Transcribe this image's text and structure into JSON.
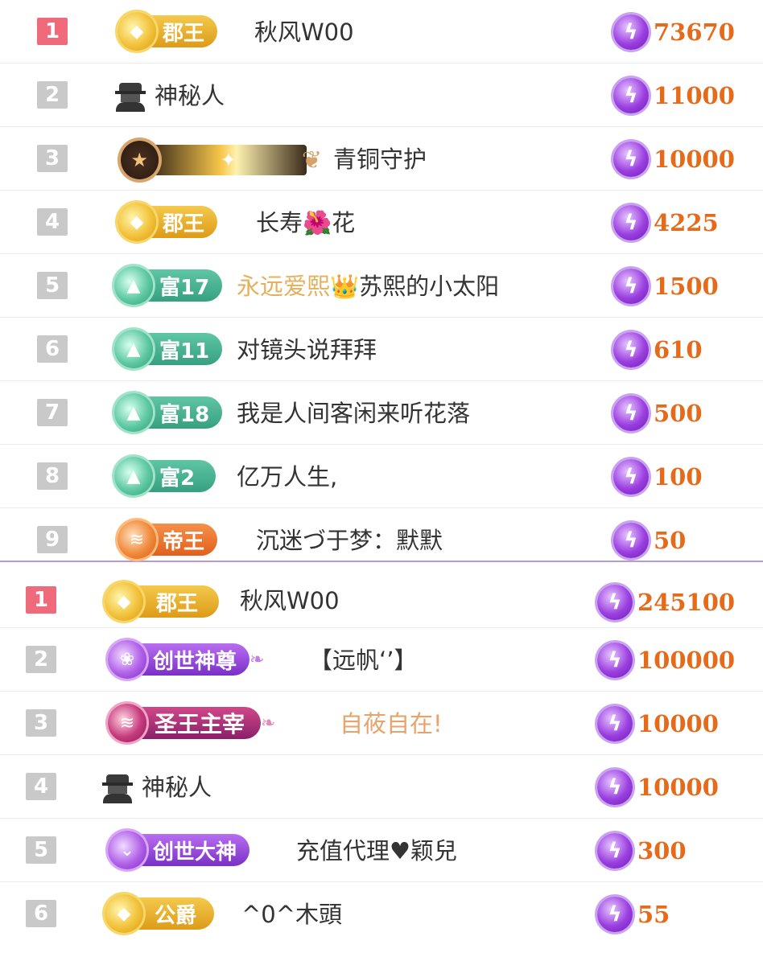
{
  "top_board": [
    {
      "rank": "1",
      "badge": {
        "style": "gold",
        "icon": "diamond-icon",
        "label": "郡王"
      },
      "name": "秋风W00",
      "score": "73670"
    },
    {
      "rank": "2",
      "badge": {
        "style": "anonymous",
        "icon": "mystery-person-icon",
        "label": ""
      },
      "name": "神秘人",
      "score": "11000"
    },
    {
      "rank": "3",
      "badge": {
        "style": "bronze",
        "icon": "star-icon",
        "label": ""
      },
      "name": "青铜守护",
      "score": "10000"
    },
    {
      "rank": "4",
      "badge": {
        "style": "gold",
        "icon": "diamond-icon",
        "label": "郡王"
      },
      "name_parts": [
        "长寿",
        "🌺",
        "花"
      ],
      "score": "4225"
    },
    {
      "rank": "5",
      "badge": {
        "style": "green",
        "icon": "triangle-icon",
        "label": "富17"
      },
      "name_parts": [
        "永远爱熙",
        "👑",
        "苏熙的小太阳"
      ],
      "score": "1500"
    },
    {
      "rank": "6",
      "badge": {
        "style": "green",
        "icon": "triangle-icon",
        "label": "富11"
      },
      "name": "对镜头说拜拜",
      "score": "610"
    },
    {
      "rank": "7",
      "badge": {
        "style": "green",
        "icon": "triangle-icon",
        "label": "富18"
      },
      "name": "我是人间客闲来听花落",
      "score": "500"
    },
    {
      "rank": "8",
      "badge": {
        "style": "green",
        "icon": "triangle-icon",
        "label": "富2"
      },
      "name": "亿万人生,",
      "score": "100"
    },
    {
      "rank": "9",
      "badge": {
        "style": "orange",
        "icon": "chevron-icon",
        "label": "帝王"
      },
      "name": "沉迷づ于梦：默默",
      "score": "50"
    }
  ],
  "bottom_board": [
    {
      "rank": "1",
      "badge": {
        "style": "gold",
        "icon": "diamond-icon",
        "label": "郡王"
      },
      "name": "秋风W00",
      "score": "245100"
    },
    {
      "rank": "2",
      "badge": {
        "style": "purple",
        "icon": "rose-icon",
        "label": "创世神尊"
      },
      "name": "【远帆‘’】",
      "score": "100000"
    },
    {
      "rank": "3",
      "badge": {
        "style": "crimson",
        "icon": "chevron-icon",
        "label": "圣王主宰"
      },
      "name": "自莜自在!",
      "score": "10000"
    },
    {
      "rank": "4",
      "badge": {
        "style": "anonymous",
        "icon": "mystery-person-icon",
        "label": ""
      },
      "name": "神秘人",
      "score": "10000"
    },
    {
      "rank": "5",
      "badge": {
        "style": "purple",
        "icon": "chevron-down-icon",
        "label": "创世大神"
      },
      "name": "充值代理♥颖兒",
      "score": "300"
    },
    {
      "rank": "6",
      "badge": {
        "style": "gold",
        "icon": "diamond-icon",
        "label": "公爵"
      },
      "name": "^0^木頭",
      "score": "55"
    }
  ],
  "colors": {
    "top_rank": "#ef6b7b",
    "rank": "#c9c9c9",
    "score": "#e56a1a",
    "bolt": "#9b3fe0"
  }
}
